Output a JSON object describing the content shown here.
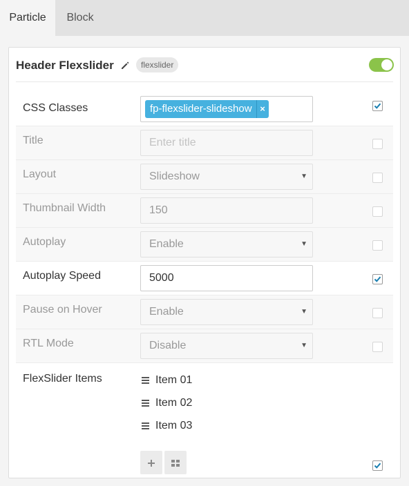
{
  "tabs": [
    {
      "label": "Particle",
      "active": true
    },
    {
      "label": "Block",
      "active": false
    }
  ],
  "header": {
    "title": "Header Flexslider",
    "badge": "flexslider",
    "enabled": true,
    "accent_color": "#8bc34a"
  },
  "fields": {
    "css_classes": {
      "label": "CSS Classes",
      "tag": "fp-flexslider-slideshow",
      "tag_remove": "×",
      "checked": true,
      "tag_color": "#46b1df"
    },
    "title": {
      "label": "Title",
      "placeholder": "Enter title",
      "checked": false
    },
    "layout": {
      "label": "Layout",
      "value": "Slideshow",
      "checked": false
    },
    "thumbnail_width": {
      "label": "Thumbnail Width",
      "value": "150",
      "checked": false
    },
    "autoplay": {
      "label": "Autoplay",
      "value": "Enable",
      "checked": false
    },
    "autoplay_speed": {
      "label": "Autoplay Speed",
      "value": "5000",
      "checked": true
    },
    "pause_on_hover": {
      "label": "Pause on Hover",
      "value": "Enable",
      "checked": false
    },
    "rtl_mode": {
      "label": "RTL Mode",
      "value": "Disable",
      "checked": false
    },
    "flexslider_items": {
      "label": "FlexSlider Items",
      "items": [
        "Item 01",
        "Item 02",
        "Item 03"
      ],
      "checked": true,
      "add_icon": "plus-icon",
      "grid_icon": "grid-icon"
    }
  }
}
